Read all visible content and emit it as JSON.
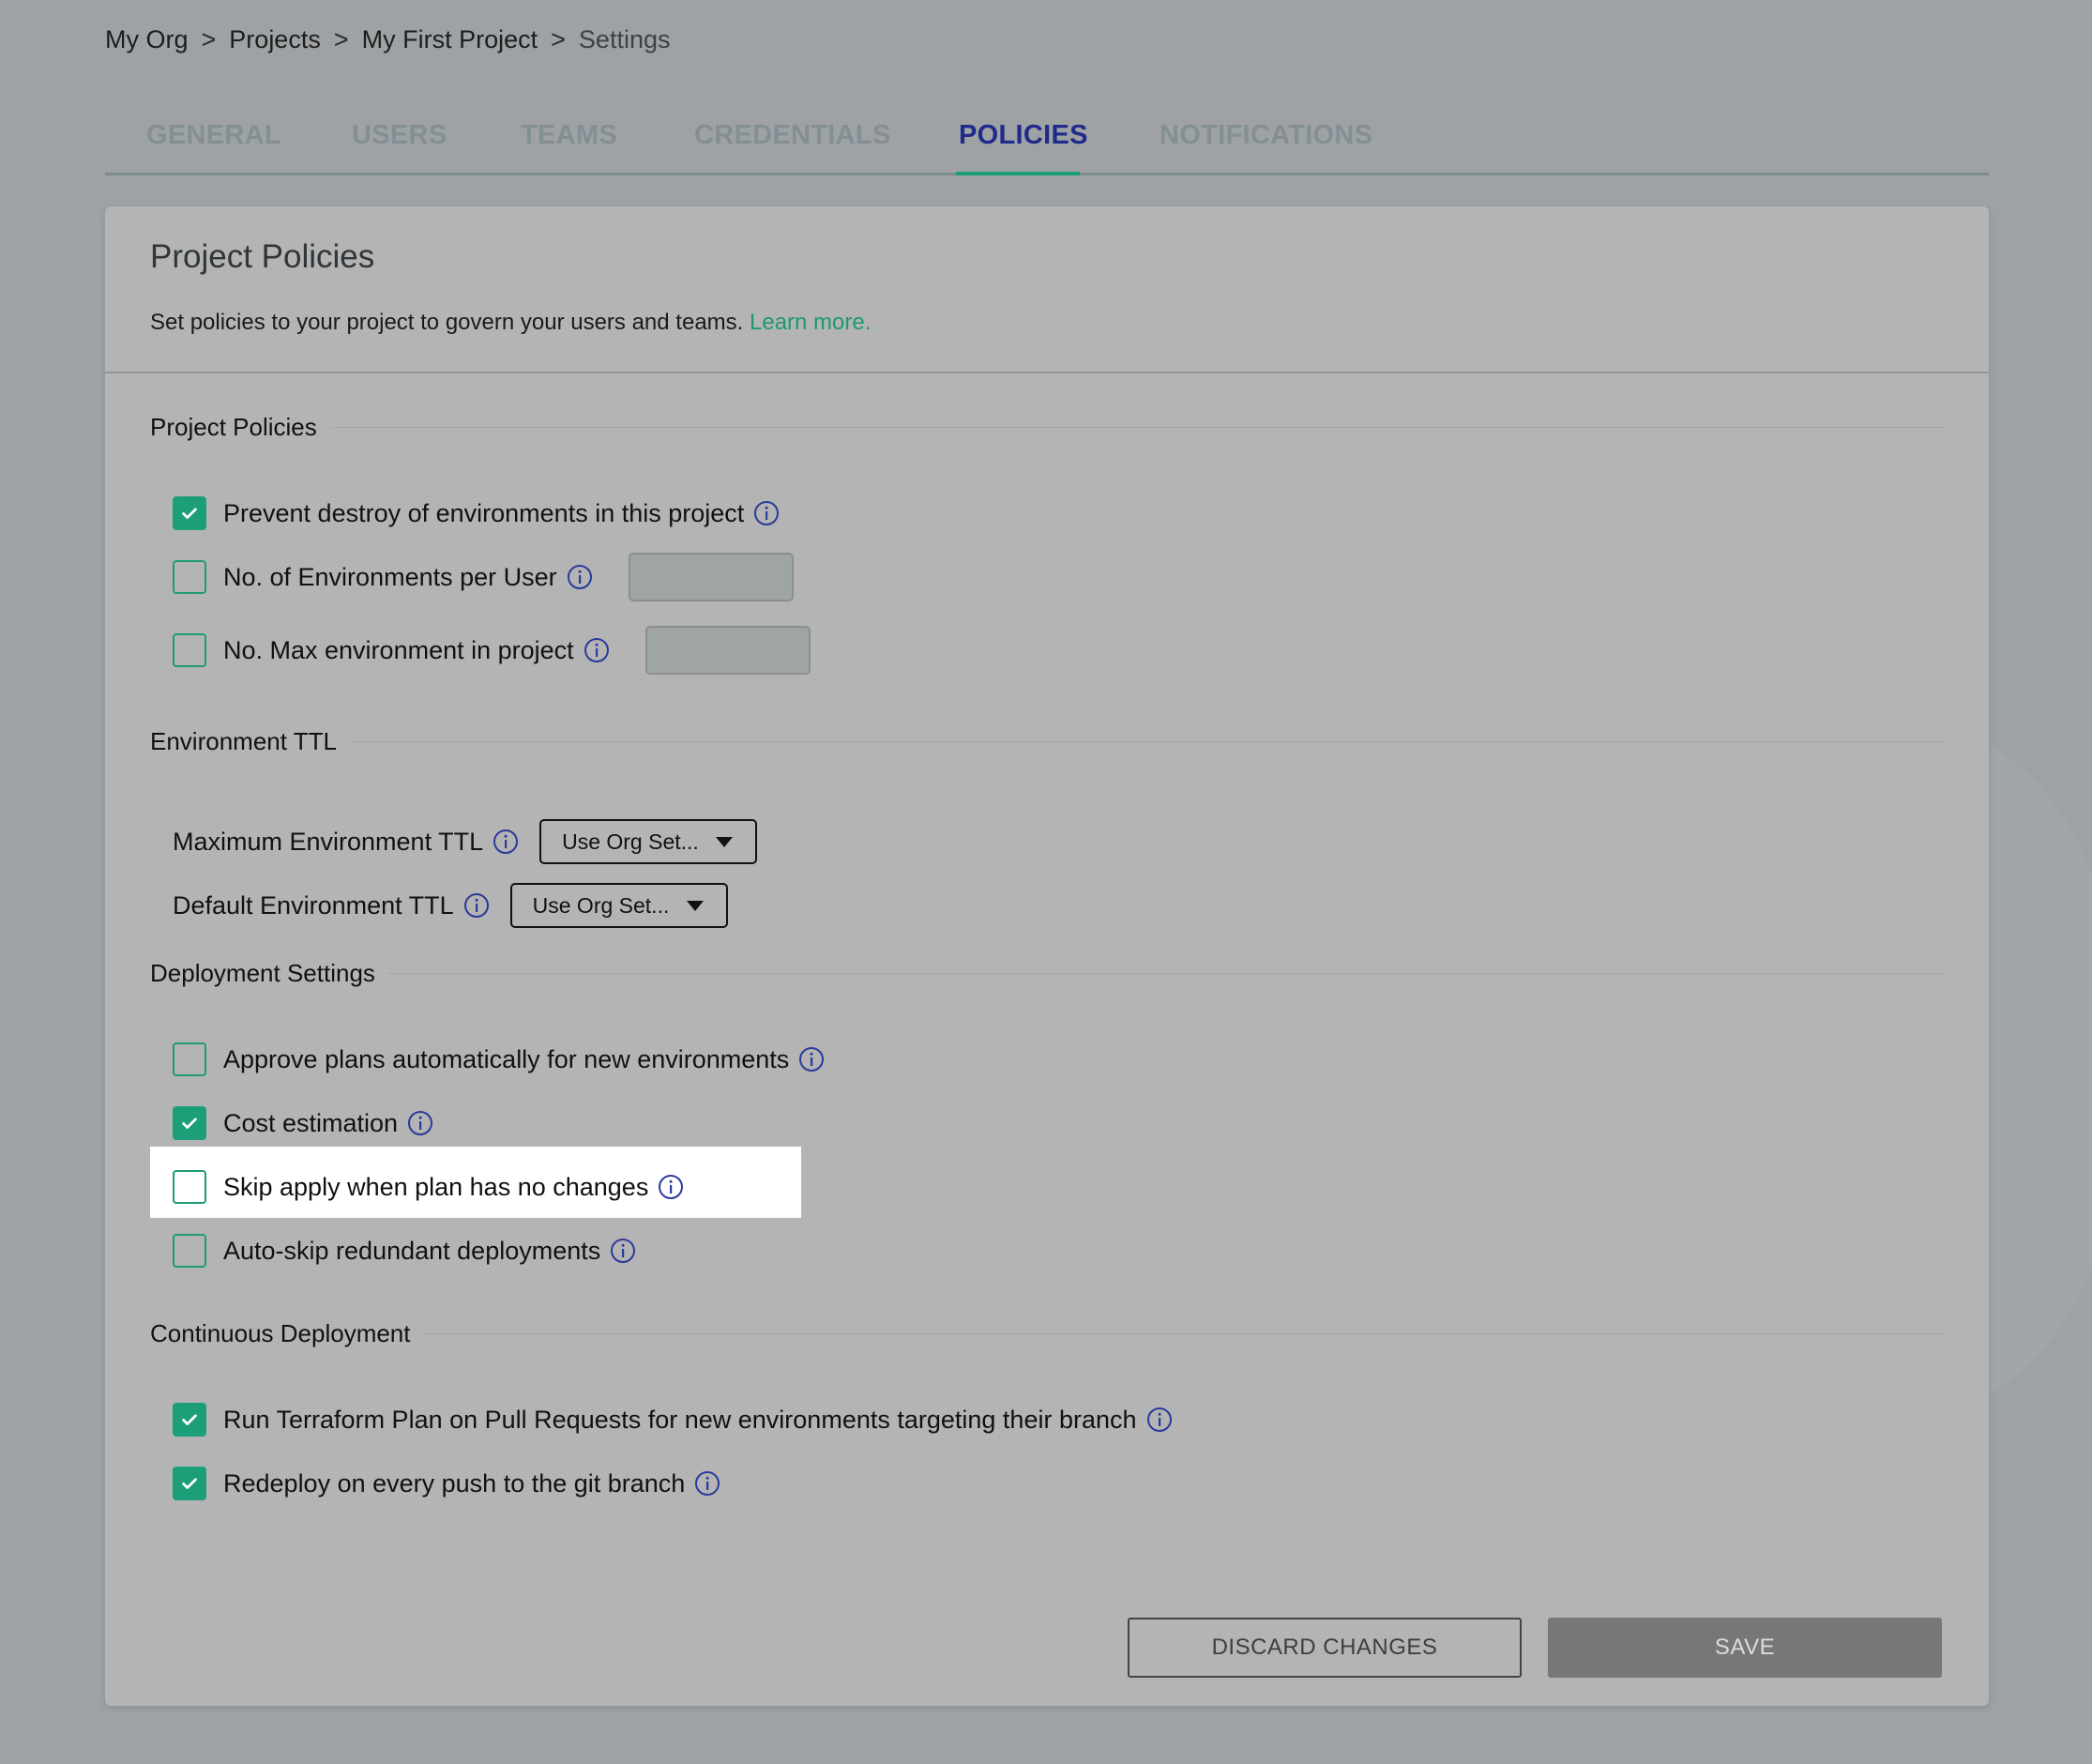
{
  "breadcrumb": {
    "items": [
      "My Org",
      "Projects",
      "My First Project",
      "Settings"
    ],
    "separator": ">"
  },
  "tabs": [
    {
      "label": "GENERAL",
      "active": false
    },
    {
      "label": "USERS",
      "active": false
    },
    {
      "label": "TEAMS",
      "active": false
    },
    {
      "label": "CREDENTIALS",
      "active": false
    },
    {
      "label": "POLICIES",
      "active": true
    },
    {
      "label": "NOTIFICATIONS",
      "active": false
    }
  ],
  "card": {
    "title": "Project Policies",
    "description": "Set policies to your project to govern your users and teams.",
    "learn_more": "Learn more."
  },
  "sections": {
    "project_policies": {
      "title": "Project Policies",
      "prevent_destroy": {
        "label": "Prevent destroy of environments in this project",
        "checked": true
      },
      "envs_per_user": {
        "label": "No. of Environments per User",
        "checked": false,
        "value": ""
      },
      "max_envs": {
        "label": "No. Max environment in project",
        "checked": false,
        "value": ""
      }
    },
    "environment_ttl": {
      "title": "Environment TTL",
      "max_ttl": {
        "label": "Maximum Environment TTL",
        "value": "Use Org Set..."
      },
      "default_ttl": {
        "label": "Default Environment TTL",
        "value": "Use Org Set..."
      }
    },
    "deployment_settings": {
      "title": "Deployment Settings",
      "auto_approve": {
        "label": "Approve plans automatically for new environments",
        "checked": false
      },
      "cost_estimation": {
        "label": "Cost estimation",
        "checked": true
      },
      "skip_apply": {
        "label": "Skip apply when plan has no changes",
        "checked": false,
        "highlighted": true
      },
      "auto_skip": {
        "label": "Auto-skip redundant deployments",
        "checked": false
      }
    },
    "continuous_deployment": {
      "title": "Continuous Deployment",
      "run_plan_pr": {
        "label": "Run Terraform Plan on Pull Requests for new environments targeting their branch",
        "checked": true
      },
      "redeploy_push": {
        "label": "Redeploy on every push to the git branch",
        "checked": true
      }
    }
  },
  "buttons": {
    "discard": "DISCARD CHANGES",
    "save": "SAVE"
  },
  "icons": {
    "info": "info-circle-icon",
    "check": "checkmark-icon",
    "caret": "caret-down-icon"
  },
  "colors": {
    "accent_green": "#1c9f78",
    "active_tab": "#1f2a8a",
    "link": "#1c9a6e",
    "info_icon": "#2a3a9a",
    "highlight": "#ffffff"
  }
}
